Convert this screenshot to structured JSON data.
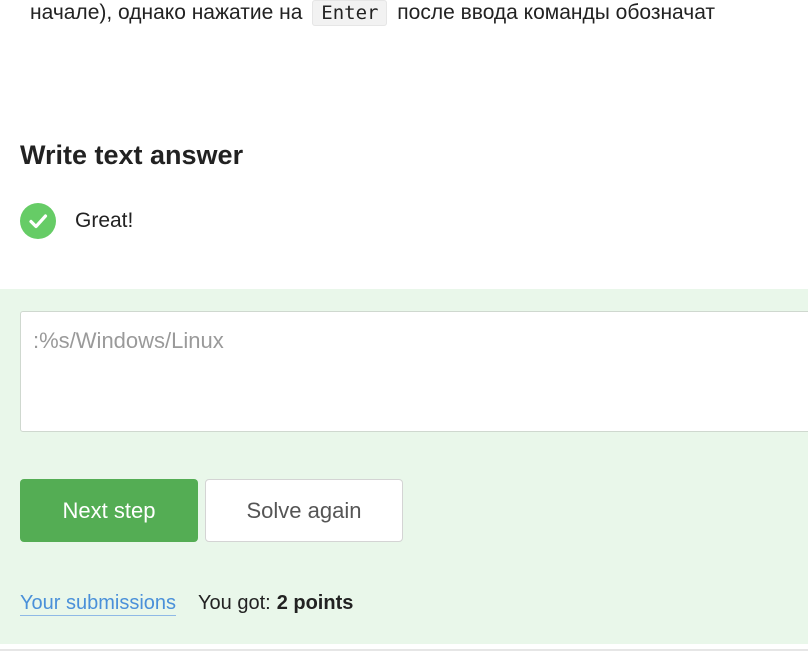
{
  "paragraph": {
    "before": "начале), однако нажатие на",
    "code": "Enter",
    "after": "после ввода команды обозначат"
  },
  "heading": "Write text answer",
  "status": {
    "text": "Great!",
    "icon": "check-circle-icon",
    "color": "#66cc66"
  },
  "answer": {
    "value": ":%s/Windows/Linux"
  },
  "buttons": {
    "next": "Next step",
    "solve_again": "Solve again"
  },
  "footer": {
    "submissions_link": "Your submissions",
    "got_label": "You got:",
    "points": "2 points"
  },
  "colors": {
    "accent_green": "#54ad54",
    "panel_bg": "#e9f7ea",
    "link": "#4a90d9"
  }
}
